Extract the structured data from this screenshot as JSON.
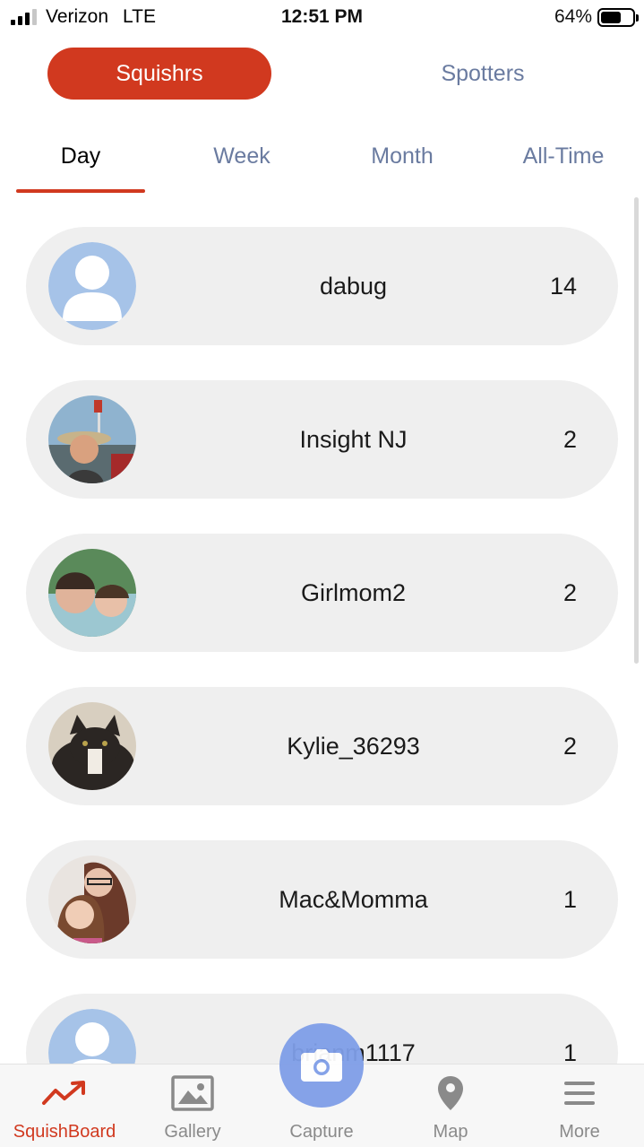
{
  "status_bar": {
    "carrier": "Verizon",
    "network": "LTE",
    "time": "12:51 PM",
    "battery_percent": "64%",
    "battery_level": 0.64
  },
  "segment": {
    "active": "Squishrs",
    "inactive": "Spotters"
  },
  "tabs": [
    {
      "label": "Day",
      "active": true
    },
    {
      "label": "Week",
      "active": false
    },
    {
      "label": "Month",
      "active": false
    },
    {
      "label": "All-Time",
      "active": false
    }
  ],
  "leaderboard": [
    {
      "name": "dabug",
      "count": "14",
      "avatar": "default-person-icon"
    },
    {
      "name": "Insight NJ",
      "count": "2",
      "avatar": "photo-man-hat"
    },
    {
      "name": "Girlmom2",
      "count": "2",
      "avatar": "photo-pool-selfie"
    },
    {
      "name": "Kylie_36293",
      "count": "2",
      "avatar": "photo-cat"
    },
    {
      "name": "Mac&Momma",
      "count": "1",
      "avatar": "photo-mother-daughter"
    },
    {
      "name": "brianm1117",
      "count": "1",
      "avatar": "default-person-icon"
    }
  ],
  "bottom_nav": [
    {
      "label": "SquishBoard",
      "icon": "trend-up-icon",
      "active": true
    },
    {
      "label": "Gallery",
      "icon": "image-icon",
      "active": false
    },
    {
      "label": "Capture",
      "icon": "camera-icon",
      "active": false
    },
    {
      "label": "Map",
      "icon": "map-pin-icon",
      "active": false
    },
    {
      "label": "More",
      "icon": "menu-icon",
      "active": false
    }
  ],
  "colors": {
    "accent": "#d1391f",
    "tab_inactive": "#6a7ba0",
    "row_bg": "#efefef",
    "capture_fab": "#7f9ee8",
    "default_avatar": "#a6c3e8"
  }
}
